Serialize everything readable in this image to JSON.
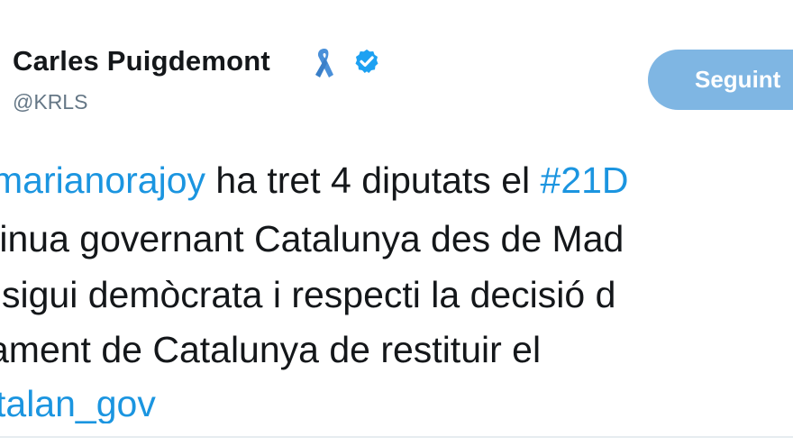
{
  "profile": {
    "name": "Carles Puigdemont",
    "handle": "@KRLS",
    "ribbon_icon": "yellow-ribbon-icon",
    "verified_icon": "verified-badge-icon"
  },
  "follow_button": {
    "label": "Seguint"
  },
  "tweet": {
    "line1": {
      "mention": "marianorajoy",
      "text": " ha tret 4 diputats el ",
      "hashtag": "#21D"
    },
    "line2": {
      "text": "tinua governant Catalunya des de Mad"
    },
    "line3": {
      "text": "sigui demòcrata i respecti la decisió d"
    },
    "line4": {
      "text": "ament de Catalunya de restituir el"
    },
    "line5": {
      "mention": "talan_gov"
    }
  },
  "colors": {
    "link": "#1b95e0",
    "verified": "#1da1f2",
    "follow_button": "#7fb6e3",
    "ribbon": "#4a90d9"
  }
}
